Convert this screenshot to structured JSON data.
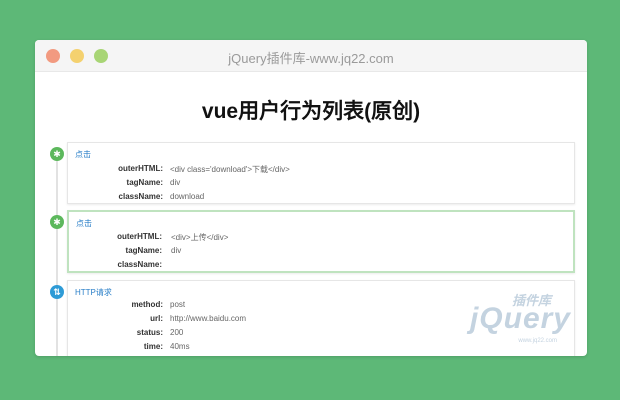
{
  "window": {
    "title": "jQuery插件库-www.jq22.com"
  },
  "page": {
    "title": "vue用户行为列表(原创)"
  },
  "entries": [
    {
      "type": "点击",
      "icon": "cursor-click-icon",
      "color": "#5cb85c",
      "fields": [
        {
          "key": "outerHTML:",
          "value": "<div class='download'>下载</div>"
        },
        {
          "key": "tagName:",
          "value": "div"
        },
        {
          "key": "className:",
          "value": "download"
        }
      ]
    },
    {
      "type": "点击",
      "icon": "cursor-click-icon",
      "color": "#5cb85c",
      "fields": [
        {
          "key": "outerHTML:",
          "value": "<div>上传</div>"
        },
        {
          "key": "tagName:",
          "value": "div"
        },
        {
          "key": "className:",
          "value": ""
        }
      ]
    },
    {
      "type": "HTTP请求",
      "icon": "network-request-icon",
      "color": "#2e9bd6",
      "fields": [
        {
          "key": "method:",
          "value": "post"
        },
        {
          "key": "url:",
          "value": "http://www.baidu.com"
        },
        {
          "key": "status:",
          "value": "200"
        },
        {
          "key": "time:",
          "value": "40ms"
        }
      ]
    }
  ],
  "watermark": {
    "top": "插件库",
    "main": "jQuery",
    "sub": "www.jq22.com"
  }
}
